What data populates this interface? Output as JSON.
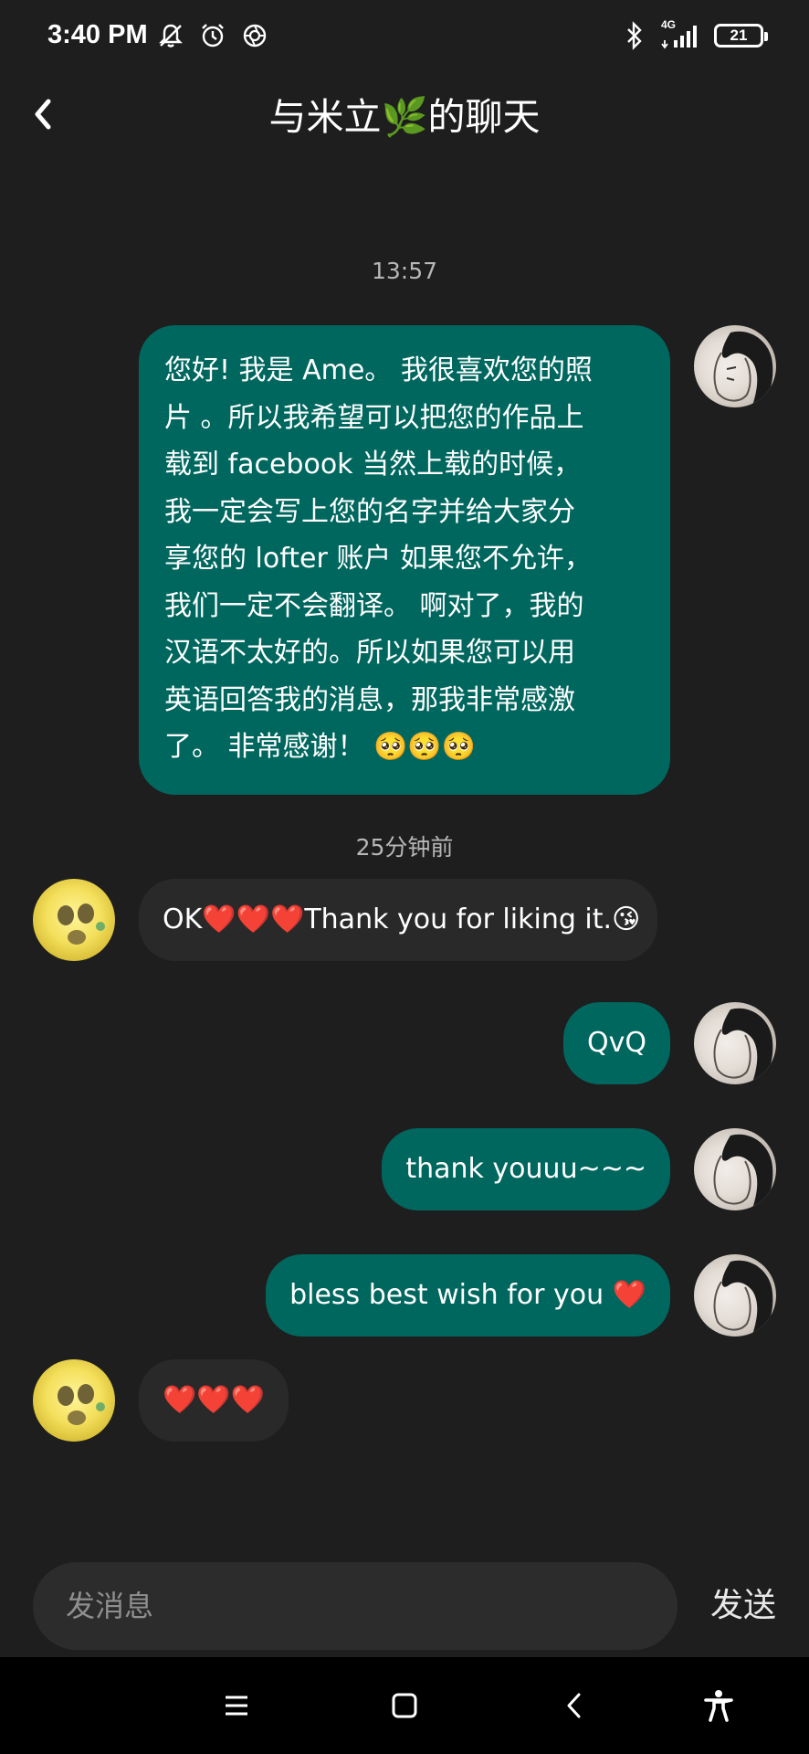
{
  "status_bar": {
    "time": "3:40 PM",
    "network": "4G",
    "battery": "21"
  },
  "header": {
    "title": "与米立🌿的聊天"
  },
  "messages": [
    {
      "type": "timestamp",
      "text": "13:57"
    },
    {
      "type": "sent",
      "text": "您好! 我是 Ame。 我很喜欢您的照\n片 。所以我希望可以把您的作品上\n载到 facebook 当然上载的时候，\n我一定会写上您的名字并给大家分\n享您的 lofter 账户 如果您不允许，\n我们一定不会翻译。 啊对了，我的\n汉语不太好的。所以如果您可以用\n英语回答我的消息，那我非常感激\n了。 非常感谢！ 🥺🥺🥺"
    },
    {
      "type": "timestamp",
      "text": "25分钟前"
    },
    {
      "type": "received",
      "text": "OK❤️❤️❤️Thank you for liking it.😘"
    },
    {
      "type": "sent",
      "text": "QvQ"
    },
    {
      "type": "sent",
      "text": "thank youuu~~~"
    },
    {
      "type": "sent",
      "text": "bless best wish for you ❤️"
    },
    {
      "type": "received",
      "text": "❤️❤️❤️"
    }
  ],
  "input": {
    "placeholder": "发消息",
    "value": ""
  },
  "send_label": "发送",
  "icons": {
    "back": "chevron-left-icon",
    "menu": "hamburger-icon",
    "home": "square-icon",
    "nav_back": "triangle-back-icon",
    "accessibility": "accessibility-icon"
  },
  "colors": {
    "background": "#1e1e1e",
    "sent_bubble": "#00675f",
    "received_bubble": "#292929",
    "nav_bar": "#000000"
  }
}
